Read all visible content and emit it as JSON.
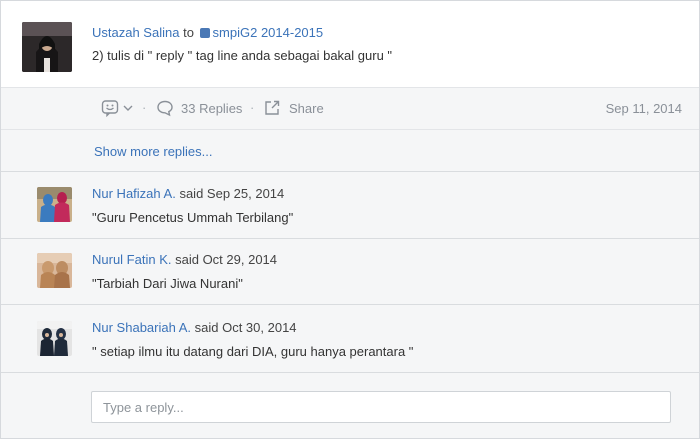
{
  "post": {
    "author": "Ustazah Salina",
    "to_word": "to",
    "group": "smpiG2 2014-2015",
    "body": "2) tulis di \" reply \" tag line anda sebagai bakal guru \""
  },
  "actions": {
    "reaction_icon": "smiley-face-icon",
    "replies_label": "33 Replies",
    "share_label": "Share",
    "date": "Sep 11, 2014"
  },
  "show_more": "Show more replies...",
  "replies": [
    {
      "author": "Nur Hafizah A.",
      "said": "said Sep 25, 2014",
      "body": "\"Guru Pencetus Ummah Terbilang\""
    },
    {
      "author": "Nurul Fatin K.",
      "said": "said Oct 29, 2014",
      "body": "\"Tarbiah Dari Jiwa Nurani\""
    },
    {
      "author": "Nur Shabariah A.",
      "said": "said Oct 30, 2014",
      "body": "\" setiap ilmu itu datang dari DIA, guru hanya perantara \""
    }
  ],
  "composer": {
    "placeholder": "Type a reply..."
  },
  "colors": {
    "link": "#3b73b9",
    "muted": "#8a9098",
    "panel": "#f5f6f7",
    "border": "#d9dcdf"
  }
}
